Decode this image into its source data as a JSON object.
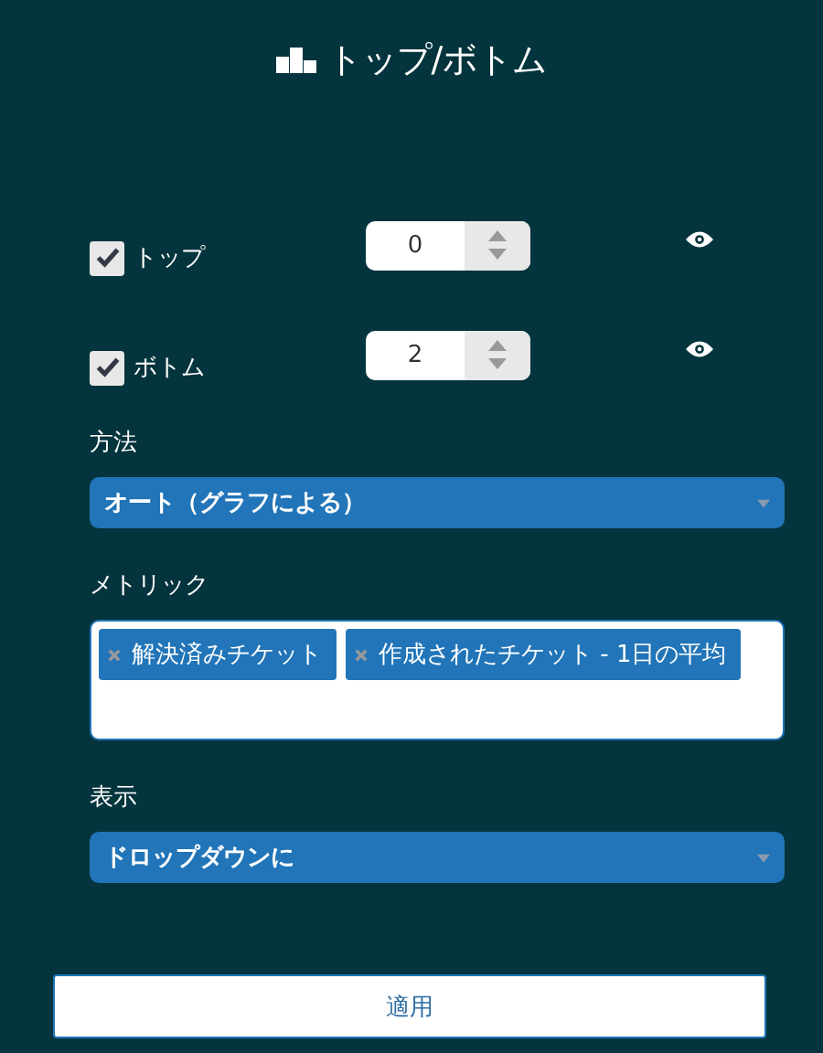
{
  "title": "トップ/ボトム",
  "limits": [
    {
      "label": "トップ",
      "checked": true,
      "value": "0"
    },
    {
      "label": "ボトム",
      "checked": true,
      "value": "2"
    }
  ],
  "method": {
    "label": "方法",
    "value": "オート（グラフによる）"
  },
  "metric": {
    "label": "メトリック",
    "tags": [
      "解決済みチケット",
      "作成されたチケット - 1日の平均"
    ]
  },
  "display": {
    "label": "表示",
    "value": "ドロップダウンに"
  },
  "apply": "適用"
}
